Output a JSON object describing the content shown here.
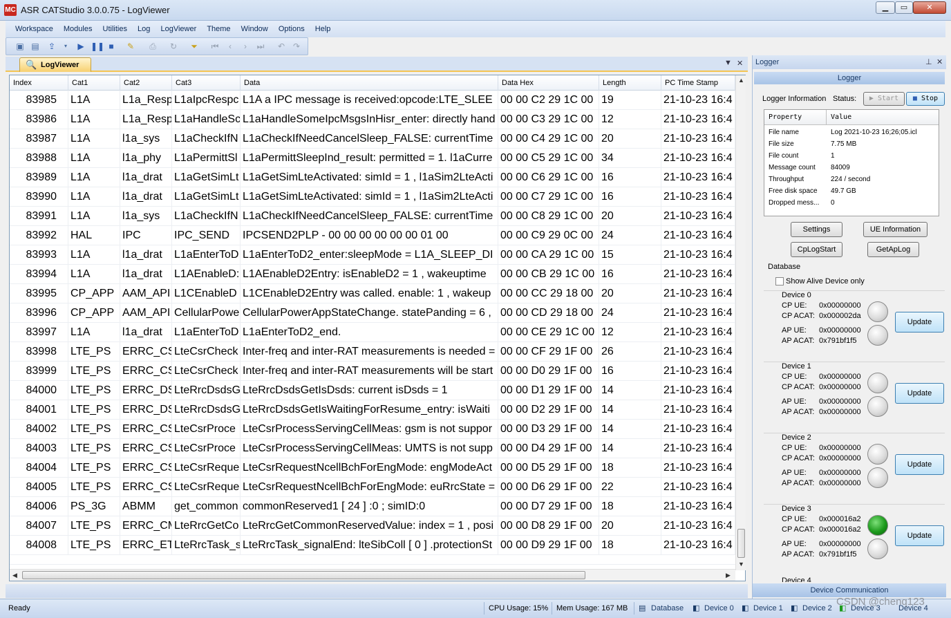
{
  "window": {
    "title": "ASR CATStudio 3.0.0.75 - LogViewer",
    "app_icon": "MC"
  },
  "menu": [
    "Workspace",
    "Modules",
    "Utilities",
    "Log",
    "LogViewer",
    "Theme",
    "Window",
    "Options",
    "Help"
  ],
  "tab": {
    "label": "LogViewer"
  },
  "columns": [
    "Index",
    "Cat1",
    "Cat2",
    "Cat3",
    "Data",
    "Data Hex",
    "Length",
    "PC Time Stamp"
  ],
  "rows": [
    [
      "83985",
      "L1A",
      "L1a_Resp",
      "L1aIpcRespc",
      "L1A a IPC message is received:opcode:LTE_SLEE",
      "00 00 C2 29 1C 00",
      "19",
      "21-10-23 16:4"
    ],
    [
      "83986",
      "L1A",
      "L1a_Resp",
      "L1aHandleSc",
      "L1aHandleSomeIpcMsgsInHisr_enter: directly hand",
      "00 00 C3 29 1C 00",
      "12",
      "21-10-23 16:4"
    ],
    [
      "83987",
      "L1A",
      "l1a_sys",
      "L1aCheckIfN",
      "L1aCheckIfNeedCancelSleep_FALSE: currentTime",
      "00 00 C4 29 1C 00",
      "20",
      "21-10-23 16:4"
    ],
    [
      "83988",
      "L1A",
      "l1a_phy",
      "L1aPermittSl",
      "L1aPermittSleepInd_result: permitted = 1. l1aCurre",
      "00 00 C5 29 1C 00",
      "34",
      "21-10-23 16:4"
    ],
    [
      "83989",
      "L1A",
      "l1a_drat",
      "L1aGetSimLt",
      "L1aGetSimLteActivated: simId = 1 , l1aSim2LteActi",
      "00 00 C6 29 1C 00",
      "16",
      "21-10-23 16:4"
    ],
    [
      "83990",
      "L1A",
      "l1a_drat",
      "L1aGetSimLt",
      "L1aGetSimLteActivated: simId = 1 , l1aSim2LteActi",
      "00 00 C7 29 1C 00",
      "16",
      "21-10-23 16:4"
    ],
    [
      "83991",
      "L1A",
      "l1a_sys",
      "L1aCheckIfN",
      "L1aCheckIfNeedCancelSleep_FALSE: currentTime",
      "00 00 C8 29 1C 00",
      "20",
      "21-10-23 16:4"
    ],
    [
      "83992",
      "HAL",
      "IPC",
      "IPC_SEND",
      "IPCSEND2PLP  - 00 00 00 00 00 00 01 00",
      "00 00 C9 29 0C 00",
      "24",
      "21-10-23 16:4"
    ],
    [
      "83993",
      "L1A",
      "l1a_drat",
      "L1aEnterToD",
      "L1aEnterToD2_enter:sleepMode = L1A_SLEEP_DI",
      "00 00 CA 29 1C 00",
      "15",
      "21-10-23 16:4"
    ],
    [
      "83994",
      "L1A",
      "l1a_drat",
      "L1AEnableD:",
      "L1AEnableD2Entry: isEnableD2 = 1 , wakeuptime",
      "00 00 CB 29 1C 00",
      "16",
      "21-10-23 16:4"
    ],
    [
      "83995",
      "CP_APP",
      "AAM_API",
      "L1CEnableD",
      "L1CEnableD2Entry was called. enable: 1 , wakeup",
      "00 00 CC 29 18 00",
      "20",
      "21-10-23 16:4"
    ],
    [
      "83996",
      "CP_APP",
      "AAM_API",
      "CellularPowe",
      "CellularPowerAppStateChange. statePanding = 6 ,",
      "00 00 CD 29 18 00",
      "24",
      "21-10-23 16:4"
    ],
    [
      "83997",
      "L1A",
      "l1a_drat",
      "L1aEnterToD",
      "L1aEnterToD2_end.",
      "00 00 CE 29 1C 00",
      "12",
      "21-10-23 16:4"
    ],
    [
      "83998",
      "LTE_PS",
      "ERRC_CS",
      "LteCsrCheck",
      "Inter-freq and inter-RAT measurements is needed =",
      "00 00 CF 29 1F 00",
      "26",
      "21-10-23 16:4"
    ],
    [
      "83999",
      "LTE_PS",
      "ERRC_CS",
      "LteCsrCheck",
      "Inter-freq and inter-RAT measurements will be start",
      "00 00 D0 29 1F 00",
      "16",
      "21-10-23 16:4"
    ],
    [
      "84000",
      "LTE_PS",
      "ERRC_DS",
      "LteRrcDsdsG",
      "LteRrcDsdsGetIsDsds: current isDsds = 1",
      "00 00 D1 29 1F 00",
      "14",
      "21-10-23 16:4"
    ],
    [
      "84001",
      "LTE_PS",
      "ERRC_DS",
      "LteRrcDsdsG",
      "LteRrcDsdsGetIsWaitingForResume_entry: isWaiti",
      "00 00 D2 29 1F 00",
      "14",
      "21-10-23 16:4"
    ],
    [
      "84002",
      "LTE_PS",
      "ERRC_CS",
      "LteCsrProce",
      "LteCsrProcessServingCellMeas: gsm is not suppor",
      "00 00 D3 29 1F 00",
      "14",
      "21-10-23 16:4"
    ],
    [
      "84003",
      "LTE_PS",
      "ERRC_CS",
      "LteCsrProce",
      "LteCsrProcessServingCellMeas: UMTS is not supp",
      "00 00 D4 29 1F 00",
      "14",
      "21-10-23 16:4"
    ],
    [
      "84004",
      "LTE_PS",
      "ERRC_CS",
      "LteCsrReque",
      "LteCsrRequestNcellBchForEngMode: engModeAct",
      "00 00 D5 29 1F 00",
      "18",
      "21-10-23 16:4"
    ],
    [
      "84005",
      "LTE_PS",
      "ERRC_CS",
      "LteCsrReque",
      "LteCsrRequestNcellBchForEngMode: euRrcState =",
      "00 00 D6 29 1F 00",
      "22",
      "21-10-23 16:4"
    ],
    [
      "84006",
      "PS_3G",
      "ABMM",
      "get_common",
      "commonReserved1 [ 24 ] :0 ; simID:0",
      "00 00 D7 29 1F 00",
      "18",
      "21-10-23 16:4"
    ],
    [
      "84007",
      "LTE_PS",
      "ERRC_CM",
      "LteRrcGetCo",
      "LteRrcGetCommonReservedValue: index = 1 , posi",
      "00 00 D8 29 1F 00",
      "20",
      "21-10-23 16:4"
    ],
    [
      "84008",
      "LTE_PS",
      "ERRC_ET",
      "LteRrcTask_s",
      "LteRrcTask_signalEnd: lteSibColl [ 0 ] .protectionSt",
      "00 00 D9 29 1F 00",
      "18",
      "21-10-23 16:4"
    ]
  ],
  "logger": {
    "title": "Logger",
    "header": "Logger",
    "info_label": "Logger Information",
    "status_label": "Status:",
    "start_label": "Start",
    "stop_label": "Stop",
    "prop_header": {
      "property": "Property",
      "value": "Value"
    },
    "props": [
      {
        "k": "File name",
        "v": "Log 2021-10-23 16;26;05.icl"
      },
      {
        "k": "File size",
        "v": "7.75 MB"
      },
      {
        "k": "File count",
        "v": "1"
      },
      {
        "k": "Message count",
        "v": "84009"
      },
      {
        "k": "Throughput",
        "v": "224 / second"
      },
      {
        "k": "Free disk space",
        "v": "49.7 GB"
      },
      {
        "k": "Dropped mess...",
        "v": "0"
      }
    ],
    "settings_label": "Settings",
    "ue_info_label": "UE Information",
    "cplogstart_label": "CpLogStart",
    "getaplog_label": "GetApLog",
    "database_label": "Database",
    "show_alive_label": "Show Alive Device only",
    "update_label": "Update",
    "lbl_cp_ue": "CP UE:",
    "lbl_cp_acat": "CP ACAT:",
    "lbl_ap_ue": "AP UE:",
    "lbl_ap_acat": "AP ACAT:",
    "devices": [
      {
        "name": "Device 0",
        "cp_ue": "0x00000000",
        "cp_acat": "0x000002da",
        "ap_ue": "0x00000000",
        "ap_acat": "0x791bf1f5",
        "cp_on": false,
        "ap_on": false
      },
      {
        "name": "Device 1",
        "cp_ue": "0x00000000",
        "cp_acat": "0x00000000",
        "ap_ue": "0x00000000",
        "ap_acat": "0x00000000",
        "cp_on": false,
        "ap_on": false
      },
      {
        "name": "Device 2",
        "cp_ue": "0x00000000",
        "cp_acat": "0x00000000",
        "ap_ue": "0x00000000",
        "ap_acat": "0x00000000",
        "cp_on": false,
        "ap_on": false
      },
      {
        "name": "Device 3",
        "cp_ue": "0x000016a2",
        "cp_acat": "0x000016a2",
        "ap_ue": "0x00000000",
        "ap_acat": "0x791bf1f5",
        "cp_on": true,
        "ap_on": false
      }
    ],
    "device4_partial": "Device 4",
    "footer": "Device Communication"
  },
  "status": {
    "ready": "Ready",
    "cpu": "CPU Usage: 15%",
    "mem": "Mem Usage: 167 MB",
    "database": "Database",
    "device0": "Device 0",
    "device1": "Device 1",
    "device2": "Device 2",
    "device3": "Device 3",
    "device4": "Device 4"
  },
  "watermark": "CSDN @chenq123"
}
